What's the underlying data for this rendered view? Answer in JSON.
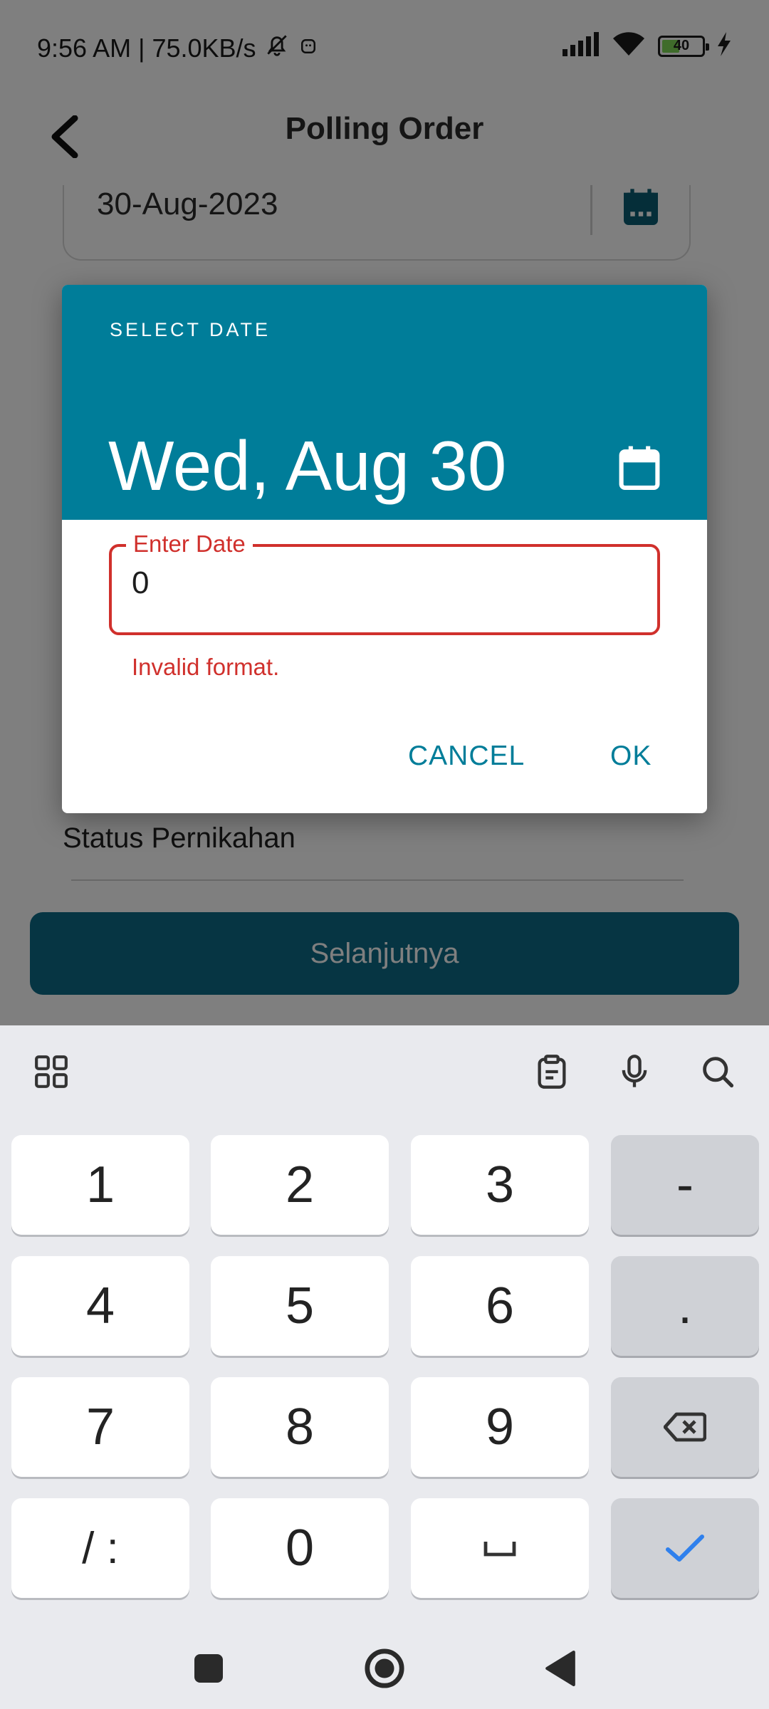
{
  "status_bar": {
    "time_speed": "9:56 AM | 75.0KB/s",
    "battery_level": "40"
  },
  "app_bar": {
    "title": "Polling Order"
  },
  "form": {
    "date_value": "30-Aug-2023",
    "status_label": "Status Pernikahan",
    "next_button": "Selanjutnya"
  },
  "dialog": {
    "overline": "SELECT DATE",
    "headline": "Wed, Aug 30",
    "field_label": "Enter Date",
    "field_value": "0",
    "error_text": "Invalid format.",
    "cancel_label": "CANCEL",
    "ok_label": "OK"
  },
  "keyboard": {
    "rows": [
      [
        "1",
        "2",
        "3",
        "-"
      ],
      [
        "4",
        "5",
        "6",
        "."
      ],
      [
        "7",
        "8",
        "9",
        "backspace"
      ],
      [
        "/ :",
        "0",
        "␣",
        "done"
      ]
    ]
  },
  "colors": {
    "accent": "#007d99",
    "error": "#d0302c",
    "button": "#0c6a86"
  }
}
